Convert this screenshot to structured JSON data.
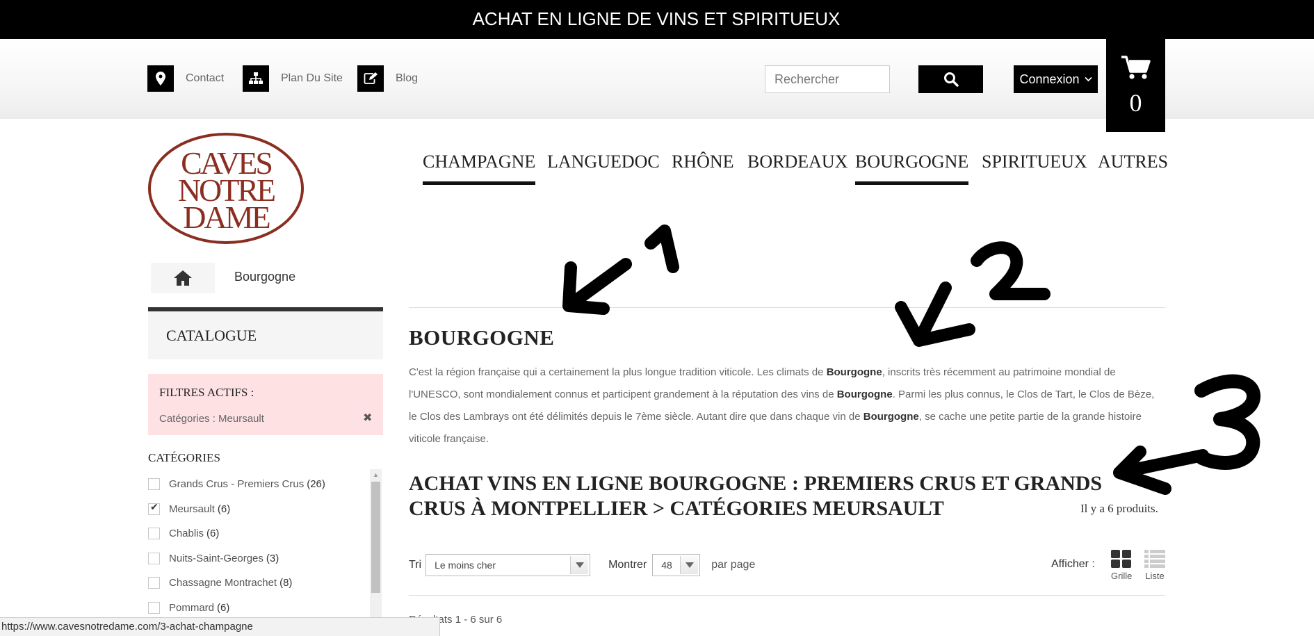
{
  "top_banner": "ACHAT EN LIGNE DE VINS ET SPIRITUEUX",
  "header": {
    "links": [
      {
        "label": "Contact",
        "icon": "map-marker-icon"
      },
      {
        "label": "Plan Du Site",
        "icon": "sitemap-icon"
      },
      {
        "label": "Blog",
        "icon": "edit-icon"
      }
    ],
    "search_placeholder": "Rechercher",
    "login_label": "Connexion",
    "cart_count": "0"
  },
  "logo": {
    "lines": [
      "CAVES",
      "NOTRE",
      "DAME"
    ],
    "color": "#8b2e22"
  },
  "nav": {
    "items": [
      {
        "label": "CHAMPAGNE",
        "underlined": true
      },
      {
        "label": "LANGUEDOC",
        "underlined": false
      },
      {
        "label": "RHÔNE",
        "underlined": false
      },
      {
        "label": "BORDEAUX",
        "underlined": false
      },
      {
        "label": "BOURGOGNE",
        "underlined": true
      },
      {
        "label": "SPIRITUEUX",
        "underlined": false
      },
      {
        "label": "AUTRES",
        "underlined": false
      }
    ]
  },
  "breadcrumb": {
    "current": "Bourgogne"
  },
  "sidebar": {
    "catalogue_title": "CATALOGUE",
    "active_filters": {
      "title": "FILTRES ACTIFS :",
      "item": "Catégories : Meursault",
      "remove_glyph": "✖"
    },
    "categories_title": "CATÉGORIES",
    "categories": [
      {
        "label": "Grands Crus - Premiers Crus",
        "count": "(26)",
        "checked": false
      },
      {
        "label": "Meursault",
        "count": "(6)",
        "checked": true
      },
      {
        "label": "Chablis",
        "count": "(6)",
        "checked": false
      },
      {
        "label": "Nuits-Saint-Georges",
        "count": "(3)",
        "checked": false
      },
      {
        "label": "Chassagne Montrachet",
        "count": "(8)",
        "checked": false
      },
      {
        "label": "Pommard",
        "count": "(6)",
        "checked": false
      }
    ]
  },
  "main": {
    "region_title": "BOURGOGNE",
    "description": {
      "t1": "C'est la région française qui a certainement la plus longue tradition viticole. Les climats de ",
      "b1": "Bourgogne",
      "t2": ", inscrits très récemment au patrimoine mondial de l'UNESCO, sont mondialement connus et participent grandement à la réputation des vins de ",
      "b2": "Bourgogne",
      "t3": ". Parmi les plus connus, le Clos de Tart, le Clos de Bèze, le Clos des Lambrays ont été délimités depuis le 7ème siècle. Autant dire que dans chaque vin de ",
      "b3": "Bourgogne",
      "t4": ", se cache une petite partie de la grande histoire viticole française."
    },
    "heading_line1": "ACHAT VINS EN LIGNE BOURGOGNE : PREMIERS CRUS ET GRANDS",
    "heading_line2": "CRUS À MONTPELLIER > CATÉGORIES MEURSAULT",
    "product_count": "Il y a 6 produits.",
    "sort_label": "Tri",
    "sort_value": "Le moins cher",
    "show_label": "Montrer",
    "show_value": "48",
    "per_page": "par page",
    "view_label": "Afficher :",
    "view_grid": "Grille",
    "view_list": "Liste",
    "results": "Résultats 1 - 6 sur 6"
  },
  "annotations": [
    "1",
    "2",
    "3"
  ],
  "status_bar_url": "https://www.cavesnotredame.com/3-achat-champagne"
}
